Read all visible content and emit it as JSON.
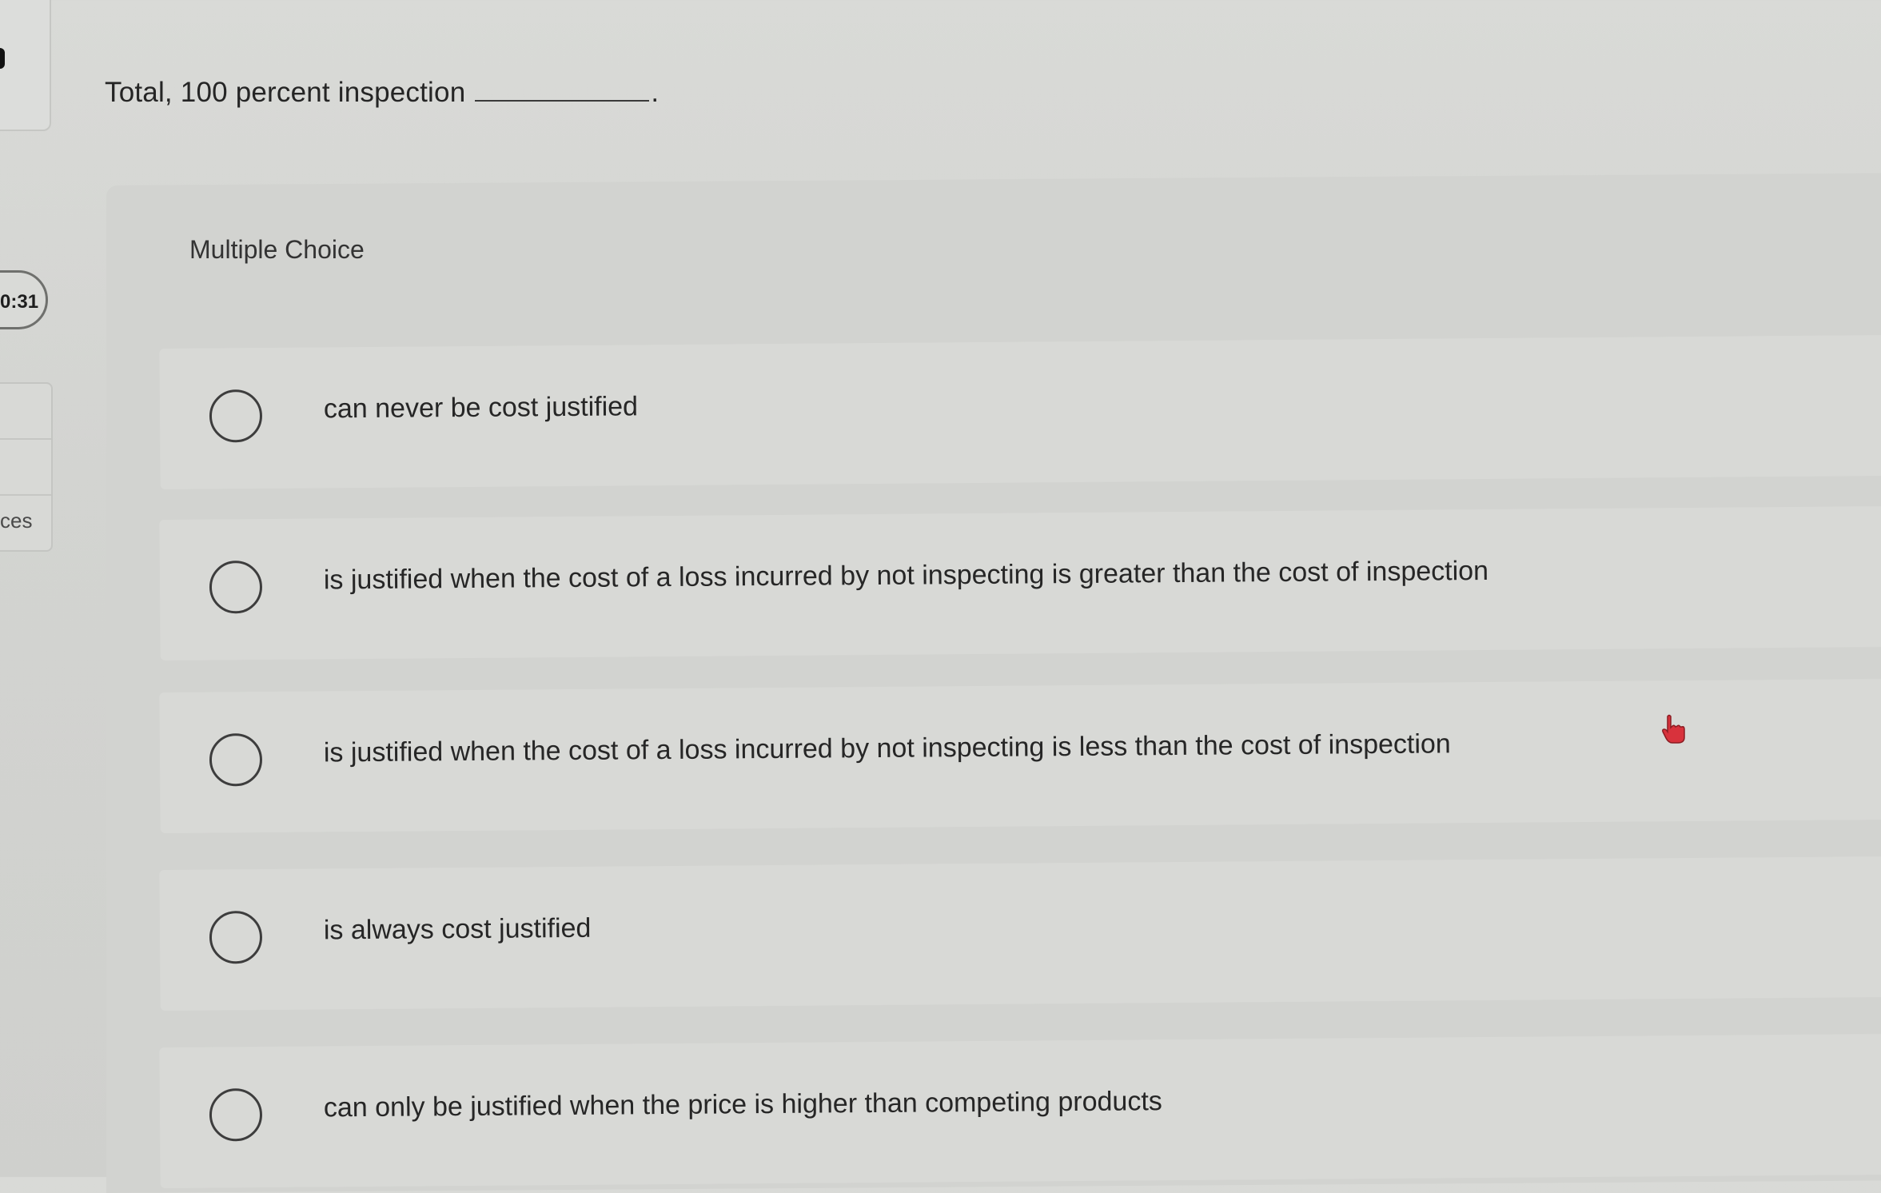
{
  "sidebar": {
    "timer": "0:31",
    "resources_label": "ces"
  },
  "question": {
    "text": "Total, 100 percent inspection",
    "blank_suffix": "."
  },
  "panel": {
    "heading": "Multiple Choice",
    "options": [
      {
        "label": "can never be cost justified"
      },
      {
        "label": "is justified when the cost of a loss incurred by not inspecting is greater than the cost of inspection"
      },
      {
        "label": "is justified when the cost of a loss incurred by not inspecting is less than the cost of inspection"
      },
      {
        "label": "is always cost justified"
      },
      {
        "label": "can only be justified when the price is higher than competing products"
      }
    ]
  },
  "cursor": {
    "icon": "hand-pointer-icon",
    "color": "#d8323c"
  }
}
